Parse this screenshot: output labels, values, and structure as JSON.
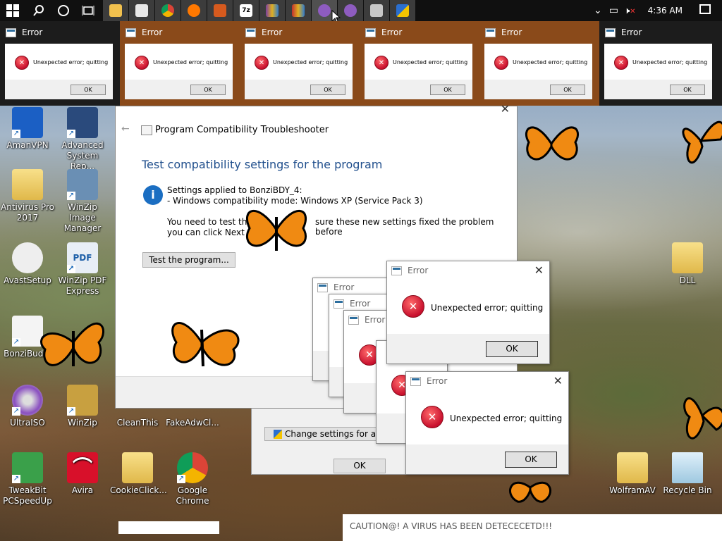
{
  "taskbar": {
    "time": "4:36 AM",
    "apps": [
      "start",
      "search",
      "task-view",
      "timeline",
      "file-explorer",
      "store",
      "chrome",
      "avast",
      "tool",
      "7zip",
      "winrar",
      "bonzi-buddy-1",
      "bonzi-buddy-2",
      "display",
      "defender"
    ]
  },
  "thumbnails": [
    {
      "title": "Error",
      "message": "Unexpected error; quitting",
      "ok": "OK"
    },
    {
      "title": "Error",
      "message": "Unexpected error; quitting",
      "ok": "OK"
    },
    {
      "title": "Error",
      "message": "Unexpected error; quitting",
      "ok": "OK"
    },
    {
      "title": "Error",
      "message": "Unexpected error; quitting",
      "ok": "OK"
    },
    {
      "title": "Error",
      "message": "Unexpected error; quitting",
      "ok": "OK"
    },
    {
      "title": "Error",
      "message": "Unexpected error; quitting",
      "ok": "OK"
    }
  ],
  "desktop_icons": [
    {
      "label": "AmanVPN"
    },
    {
      "label": "Advanced System Rep..."
    },
    {
      "label": "Antivirus Pro 2017"
    },
    {
      "label": "WinZip Image Manager"
    },
    {
      "label": "AvastSetup"
    },
    {
      "label": "WinZip PDF Express"
    },
    {
      "label": "BonziBud..."
    },
    {
      "label": "UltraISO"
    },
    {
      "label": "WinZip"
    },
    {
      "label": "CleanThis"
    },
    {
      "label": "FakeAdwCl..."
    },
    {
      "label": "TweakBit PCSpeedUp"
    },
    {
      "label": "Avira"
    },
    {
      "label": "CookieClick..."
    },
    {
      "label": "Google Chrome"
    },
    {
      "label": "DLL"
    },
    {
      "label": "WolframAV"
    },
    {
      "label": "Recycle Bin"
    }
  ],
  "troubleshooter": {
    "title": "Program Compatibility Troubleshooter",
    "heading": "Test compatibility settings for the program",
    "settings_line1": "Settings applied to BonziBDY_4:",
    "settings_line2": "- Windows compatibility mode: Windows XP (Service Pack 3)",
    "instr_line1": "You need to test the",
    "instr_line1b": "sure these new settings fixed the problem before",
    "instr_line2": "you can click Next to c",
    "test_button": "Test the program..."
  },
  "behind_window": {
    "change_settings": "Change settings for all user",
    "ok": "OK"
  },
  "error_dialogs": {
    "title": "Error",
    "message": "Unexpected error; quitting",
    "ok": "OK"
  },
  "caution_text": "CAUTION@! A VIRUS HAS BEEN DETECECETD!!!",
  "colors": {
    "taskbar": "#101010",
    "thumb_active": "#8a4a1a",
    "accent": "#0078d7",
    "heading_blue": "#1f4e8c"
  }
}
